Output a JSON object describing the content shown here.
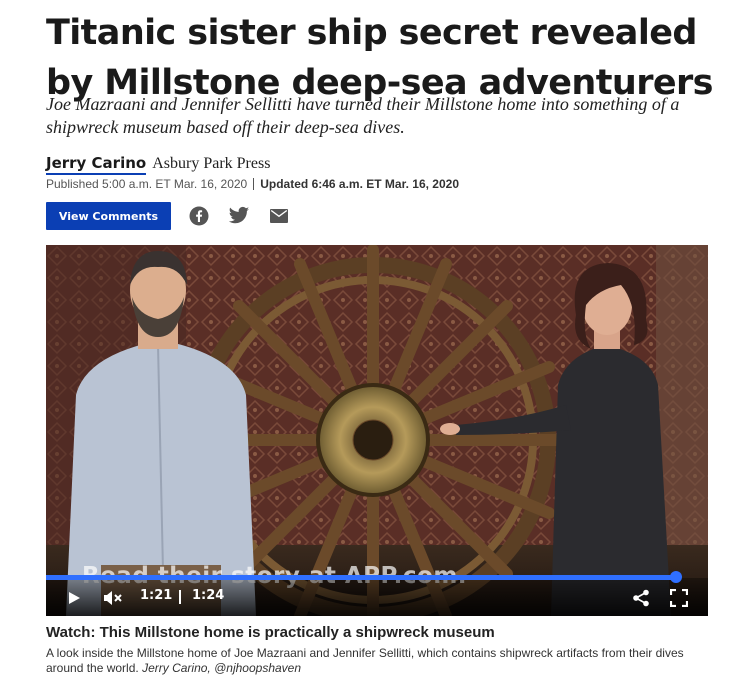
{
  "article": {
    "headline": "Titanic sister ship secret revealed by Millstone deep-sea adventurers",
    "dek": "Joe Mazraani and Jennifer Sellitti have turned their Millstone home into something of a shipwreck museum based off their deep-sea dives.",
    "author": "Jerry Carino",
    "publication": "Asbury Park Press",
    "published": "Published 5:00 a.m. ET Mar. 16, 2020",
    "updated": "Updated 6:46 a.m. ET Mar. 16, 2020"
  },
  "actions": {
    "comments_label": "View Comments",
    "share_icons": [
      "facebook-icon",
      "twitter-icon",
      "email-icon"
    ]
  },
  "video": {
    "overlay_text": "Read their story at APP.com.",
    "progress": 0.96,
    "current_time": "1:21",
    "duration": "1:24",
    "controls": [
      "play-icon",
      "mute-icon",
      "share-icon",
      "fullscreen-icon"
    ]
  },
  "caption": {
    "title": "Watch: This Millstone home is practically a shipwreck museum",
    "body": "A look inside the Millstone home of Joe Mazraani and Jennifer Sellitti, which contains shipwreck artifacts from their dives around the world.",
    "credit": "Jerry Carino, @njhoopshaven"
  },
  "colors": {
    "accent": "#0b3fb4",
    "progress": "#2f6fff"
  }
}
